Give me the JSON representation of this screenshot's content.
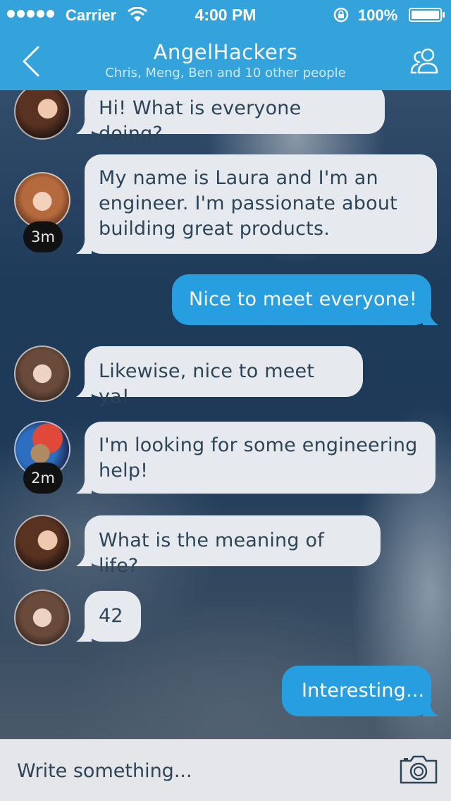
{
  "status_bar": {
    "carrier": "Carrier",
    "time": "4:00 PM",
    "battery": "100%"
  },
  "header": {
    "title": "AngelHackers",
    "subtitle": "Chris, Meng, Ben and 10 other people",
    "back_icon": "chevron-left-icon",
    "people_icon": "people-icon"
  },
  "messages": [
    {
      "direction": "in",
      "text": "Hi! What is everyone doing?"
    },
    {
      "direction": "in",
      "text_lines": [
        "My name is Laura and I'm an",
        "engineer. I'm passionate about",
        "building great products."
      ],
      "time": "3m"
    },
    {
      "direction": "out",
      "text": "Nice to meet everyone!"
    },
    {
      "direction": "in",
      "text": "Likewise, nice to meet ya!"
    },
    {
      "direction": "in",
      "text_lines": [
        "I'm looking for some engineering",
        "help!"
      ],
      "time": "2m"
    },
    {
      "direction": "in",
      "text": "What is the meaning of life?"
    },
    {
      "direction": "in",
      "text": "42"
    },
    {
      "direction": "out",
      "text": "Interesting..."
    }
  ],
  "composer": {
    "placeholder": "Write something...",
    "camera_icon": "camera-icon"
  },
  "colors": {
    "header": "#34a2db",
    "outgoing_bubble": "#279ee0",
    "incoming_bubble": "#e6e9ed",
    "incoming_text": "#2e4457"
  }
}
